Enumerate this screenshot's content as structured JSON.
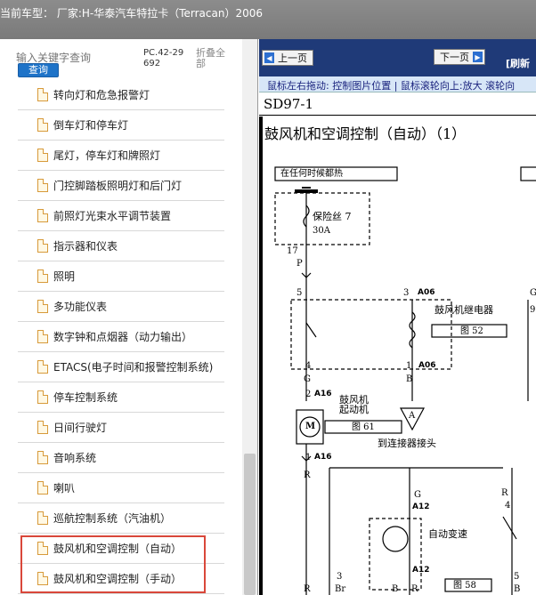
{
  "header": {
    "title": "当前车型： 厂家:H-华泰汽车特拉卡（Terracan）2006"
  },
  "sidebar": {
    "search_placeholder": "输入关键字查询",
    "search_button": "查询",
    "pc_code": "PC.42-29692",
    "collapse_all": "折叠全部",
    "items": [
      "转向灯和危急报警灯",
      "倒车灯和停车灯",
      "尾灯，停车灯和牌照灯",
      "门控脚踏板照明灯和后门灯",
      "前照灯光束水平调节装置",
      "指示器和仪表",
      "照明",
      "多功能仪表",
      "数字钟和点烟器（动力输出）",
      "ETACS(电子时间和报警控制系统)",
      "停车控制系统",
      "日间行驶灯",
      "音响系统",
      "喇叭",
      "巡航控制系统（汽油机）",
      "鼓风机和空调控制（自动）",
      "鼓风机和空调控制（手动）"
    ]
  },
  "viewer": {
    "prev_label": "上一页",
    "next_label": "下一页",
    "refresh_label": "[刷新",
    "hint": "鼠标左右拖动: 控制图片位置 | 鼠标滚轮向上:放大  滚轮向",
    "code": "SD97-1",
    "diagram_title": "鼓风机和空调控制（自动）（1）",
    "labels": {
      "always_hot": "在任何时候都热",
      "fuse": "保险丝 7",
      "amp": "30A",
      "pin17": "17",
      "pinP": "P",
      "pin5": "5",
      "pin3": "3",
      "a06_top": "A06",
      "blower_relay": "鼓风机继电器",
      "fig52": "图 52",
      "g_right": "G",
      "pin9": "9",
      "pin4": "4",
      "pin1": "1",
      "a06_bot": "A06",
      "g_left": "G",
      "b_left": "B",
      "pin2": "2",
      "a16_top": "A16",
      "blower_motor": "鼓风机\n起动机",
      "m": "M",
      "fig61": "图 61",
      "a": "A",
      "to_connector": "到连接器接头",
      "pin1b": "1",
      "a16_bot": "A16",
      "r_left": "R",
      "r_right": "R",
      "pin4b": "4",
      "g_small": "G",
      "a12_top": "A12",
      "auto_change": "自动变速",
      "fig58": "图 58",
      "a12_bot": "A12",
      "pin3b": "3",
      "br": "Br",
      "b_mid": "B",
      "b_r": "B",
      "r_bot": "R",
      "r_bot2": "R",
      "pin5b": "5"
    }
  },
  "colors": {
    "nav_bg": "#1f3a78",
    "highlight": "#d9473a",
    "search_button": "#1e73c8"
  }
}
